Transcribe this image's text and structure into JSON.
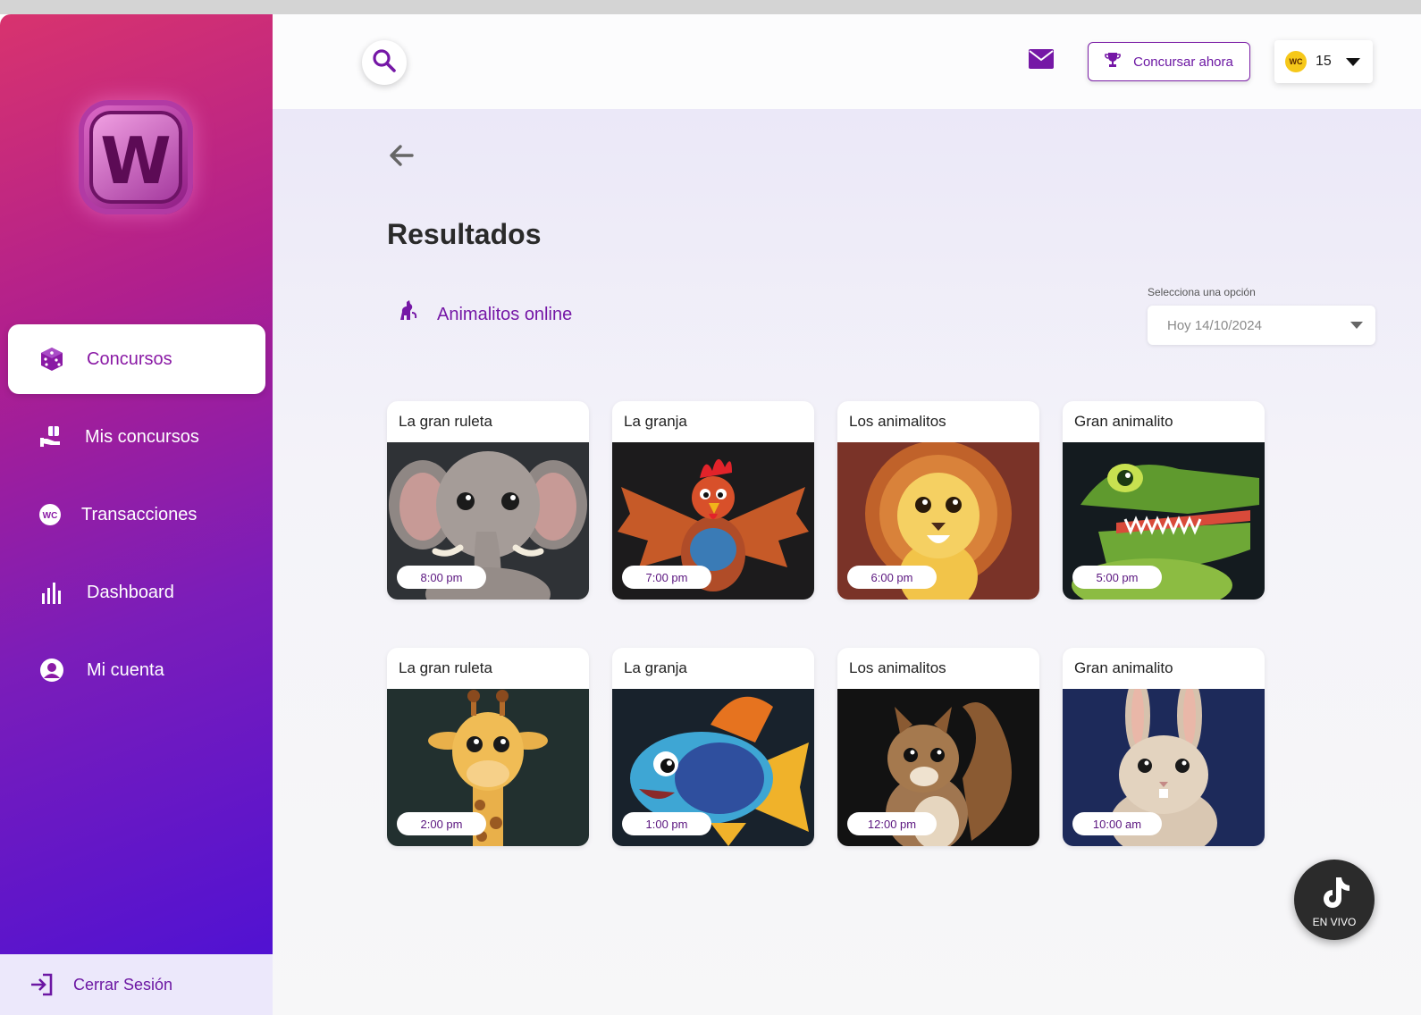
{
  "brand": {
    "logo_letter": "W"
  },
  "sidebar": {
    "items": [
      {
        "label": "Concursos",
        "icon": "dice-icon",
        "active": true
      },
      {
        "label": "Mis concursos",
        "icon": "hand-gift-icon",
        "active": false
      },
      {
        "label": "Transacciones",
        "icon": "wc-coin-icon",
        "active": false
      },
      {
        "label": "Dashboard",
        "icon": "bar-chart-icon",
        "active": false
      },
      {
        "label": "Mi cuenta",
        "icon": "user-circle-icon",
        "active": false
      }
    ],
    "logout_label": "Cerrar Sesión"
  },
  "header": {
    "cta_label": "Concursar ahora",
    "coin_label": "WC",
    "balance": "15"
  },
  "main": {
    "title": "Resultados",
    "game_name": "Animalitos online",
    "select_label": "Selecciona una opción",
    "select_value": "Hoy 14/10/2024",
    "cards": [
      {
        "title": "La gran ruleta",
        "time": "8:00 pm",
        "animal": "elephant"
      },
      {
        "title": "La granja",
        "time": "7:00 pm",
        "animal": "rooster"
      },
      {
        "title": "Los animalitos",
        "time": "6:00 pm",
        "animal": "lion"
      },
      {
        "title": "Gran animalito",
        "time": "5:00 pm",
        "animal": "crocodile"
      },
      {
        "title": "La gran ruleta",
        "time": "2:00 pm",
        "animal": "giraffe"
      },
      {
        "title": "La granja",
        "time": "1:00 pm",
        "animal": "fish"
      },
      {
        "title": "Los animalitos",
        "time": "12:00 pm",
        "animal": "squirrel"
      },
      {
        "title": "Gran animalito",
        "time": "10:00 am",
        "animal": "rabbit"
      }
    ]
  },
  "live": {
    "label": "EN VIVO"
  },
  "colors": {
    "accent": "#7517a6",
    "sidebar_top": "#d8336e",
    "sidebar_bottom": "#4a10d6",
    "coin": "#f6c81a"
  }
}
